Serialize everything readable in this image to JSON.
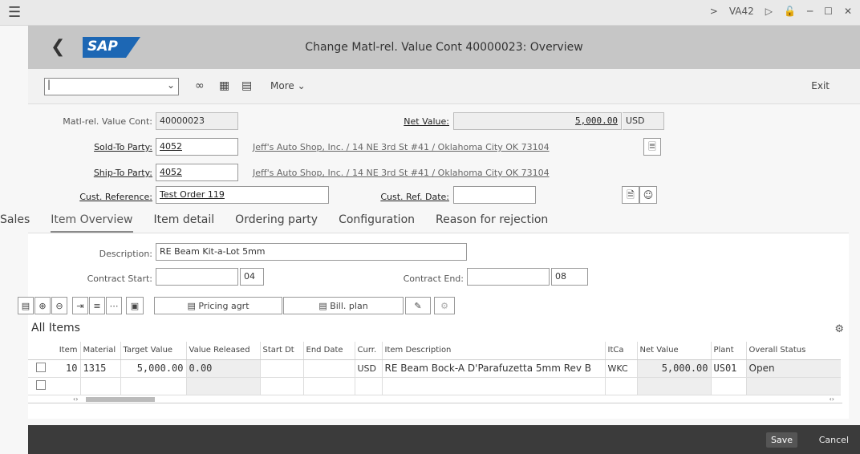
{
  "system": {
    "menu_icon": "hamburger-icon",
    "tcode": "VA42",
    "nav_arrow": ">"
  },
  "titlebar": {
    "logo": "SAP",
    "title": "Change Matl-rel. Value Cont 40000023: Overview"
  },
  "toolbar": {
    "select_value": "|",
    "more_label": "More",
    "exit_label": "Exit"
  },
  "header": {
    "contract_label": "Matl-rel. Value Cont:",
    "contract_value": "40000023",
    "net_value_label": "Net Value:",
    "net_value": "5,000.00",
    "currency": "USD",
    "sold_to_label": "Sold-To Party:",
    "sold_to_value": "4052",
    "sold_to_desc": "Jeff's Auto Shop, Inc. / 14 NE 3rd St #41 / Oklahoma City OK 73104",
    "ship_to_label": "Ship-To Party:",
    "ship_to_value": "4052",
    "ship_to_desc": "Jeff's Auto Shop, Inc. / 14 NE 3rd St #41 / Oklahoma City OK 73104",
    "cust_ref_label": "Cust. Reference:",
    "cust_ref_value": "Test Order 119",
    "cust_ref_date_label": "Cust. Ref. Date:",
    "cust_ref_date_value": ""
  },
  "tabs": [
    "Sales",
    "Item Overview",
    "Item detail",
    "Ordering party",
    "Configuration",
    "Reason for rejection"
  ],
  "item_overview": {
    "description_label": "Description:",
    "description_value": "RE Beam Kit-a-Lot 5mm",
    "contract_start_label": "Contract Start:",
    "contract_start_value": "",
    "contract_start_code": "04",
    "contract_end_label": "Contract End:",
    "contract_end_value": "",
    "contract_end_code": "08",
    "pricing_agrt_label": "Pricing agrt",
    "bill_plan_label": "Bill. plan",
    "all_items_label": "All Items"
  },
  "table": {
    "columns": [
      "Item",
      "Material",
      "Target Value",
      "Value Released",
      "Start Dt",
      "End Date",
      "Curr.",
      "Item Description",
      "ItCa",
      "Net Value",
      "Plant",
      "Overall Status"
    ],
    "rows": [
      [
        "10",
        "1315",
        "5,000.00",
        "0.00",
        "",
        "",
        "USD",
        "RE Beam Bock-A D'Parafuzetta 5mm Rev B",
        "WKC",
        "5,000.00",
        "US01",
        "Open"
      ],
      [
        "",
        "",
        "",
        "",
        "",
        "",
        "",
        "",
        "",
        "",
        "",
        ""
      ]
    ]
  },
  "footer": {
    "save_label": "Save",
    "cancel_label": "Cancel"
  }
}
